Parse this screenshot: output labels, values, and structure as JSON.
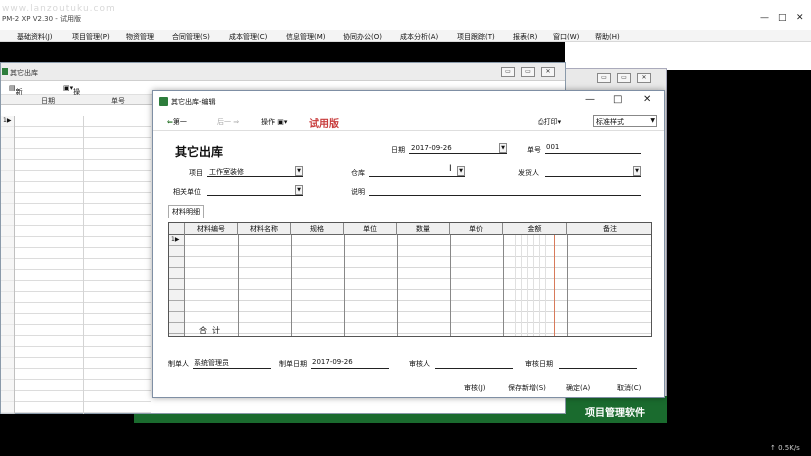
{
  "app": {
    "title": "PM-2 XP V2.30 - 试用版",
    "watermark": "www.lanzoutuku.com"
  },
  "menu": [
    "基础资料(J)",
    "项目管理(P)",
    "物资管理",
    "合同管理(S)",
    "成本管理(C)",
    "信息管理(M)",
    "协同办公(O)",
    "成本分析(A)",
    "项目跟踪(T)",
    "报表(R)",
    "窗口(W)",
    "帮助(H)"
  ],
  "back_window": {
    "title": "其它出库",
    "toolbar": {
      "new": "新增",
      "ops": "操作"
    },
    "columns": [
      "日期",
      "单号"
    ]
  },
  "brand_text": "项目管理软件",
  "speed": "0.5K/s",
  "dialog": {
    "title": "其它出库-编辑",
    "toolbar": {
      "first": "第一",
      "nav": "后一",
      "ops": "操作",
      "trial": "试用版",
      "print": "打印",
      "print_style": "标准样式"
    },
    "form_title": "其它出库",
    "fields": {
      "date_label": "日期",
      "date_value": "2017-09-26",
      "no_label": "单号",
      "no_value": "001",
      "project_label": "项目",
      "project_value": "工作室装修",
      "warehouse_label": "仓库",
      "warehouse_value": "",
      "issuer_label": "发货人",
      "issuer_value": "",
      "unit_label": "相关单位",
      "unit_value": "",
      "note_label": "说明",
      "note_value": ""
    },
    "tab_label": "材料明细",
    "grid": {
      "columns": [
        "材料编号",
        "材料名称",
        "规格",
        "单位",
        "数量",
        "单价",
        "金额",
        "备注"
      ],
      "total_label": "合计"
    },
    "footer": {
      "maker_label": "制单人",
      "maker_value": "系统管理员",
      "make_date_label": "制单日期",
      "make_date_value": "2017-09-26",
      "reviewer_label": "审核人",
      "reviewer_value": "",
      "review_date_label": "审核日期",
      "review_date_value": ""
    },
    "buttons": {
      "review": "审核(J)",
      "save_new": "保存新增(S)",
      "ok": "确定(A)",
      "cancel": "取消(C)"
    }
  }
}
